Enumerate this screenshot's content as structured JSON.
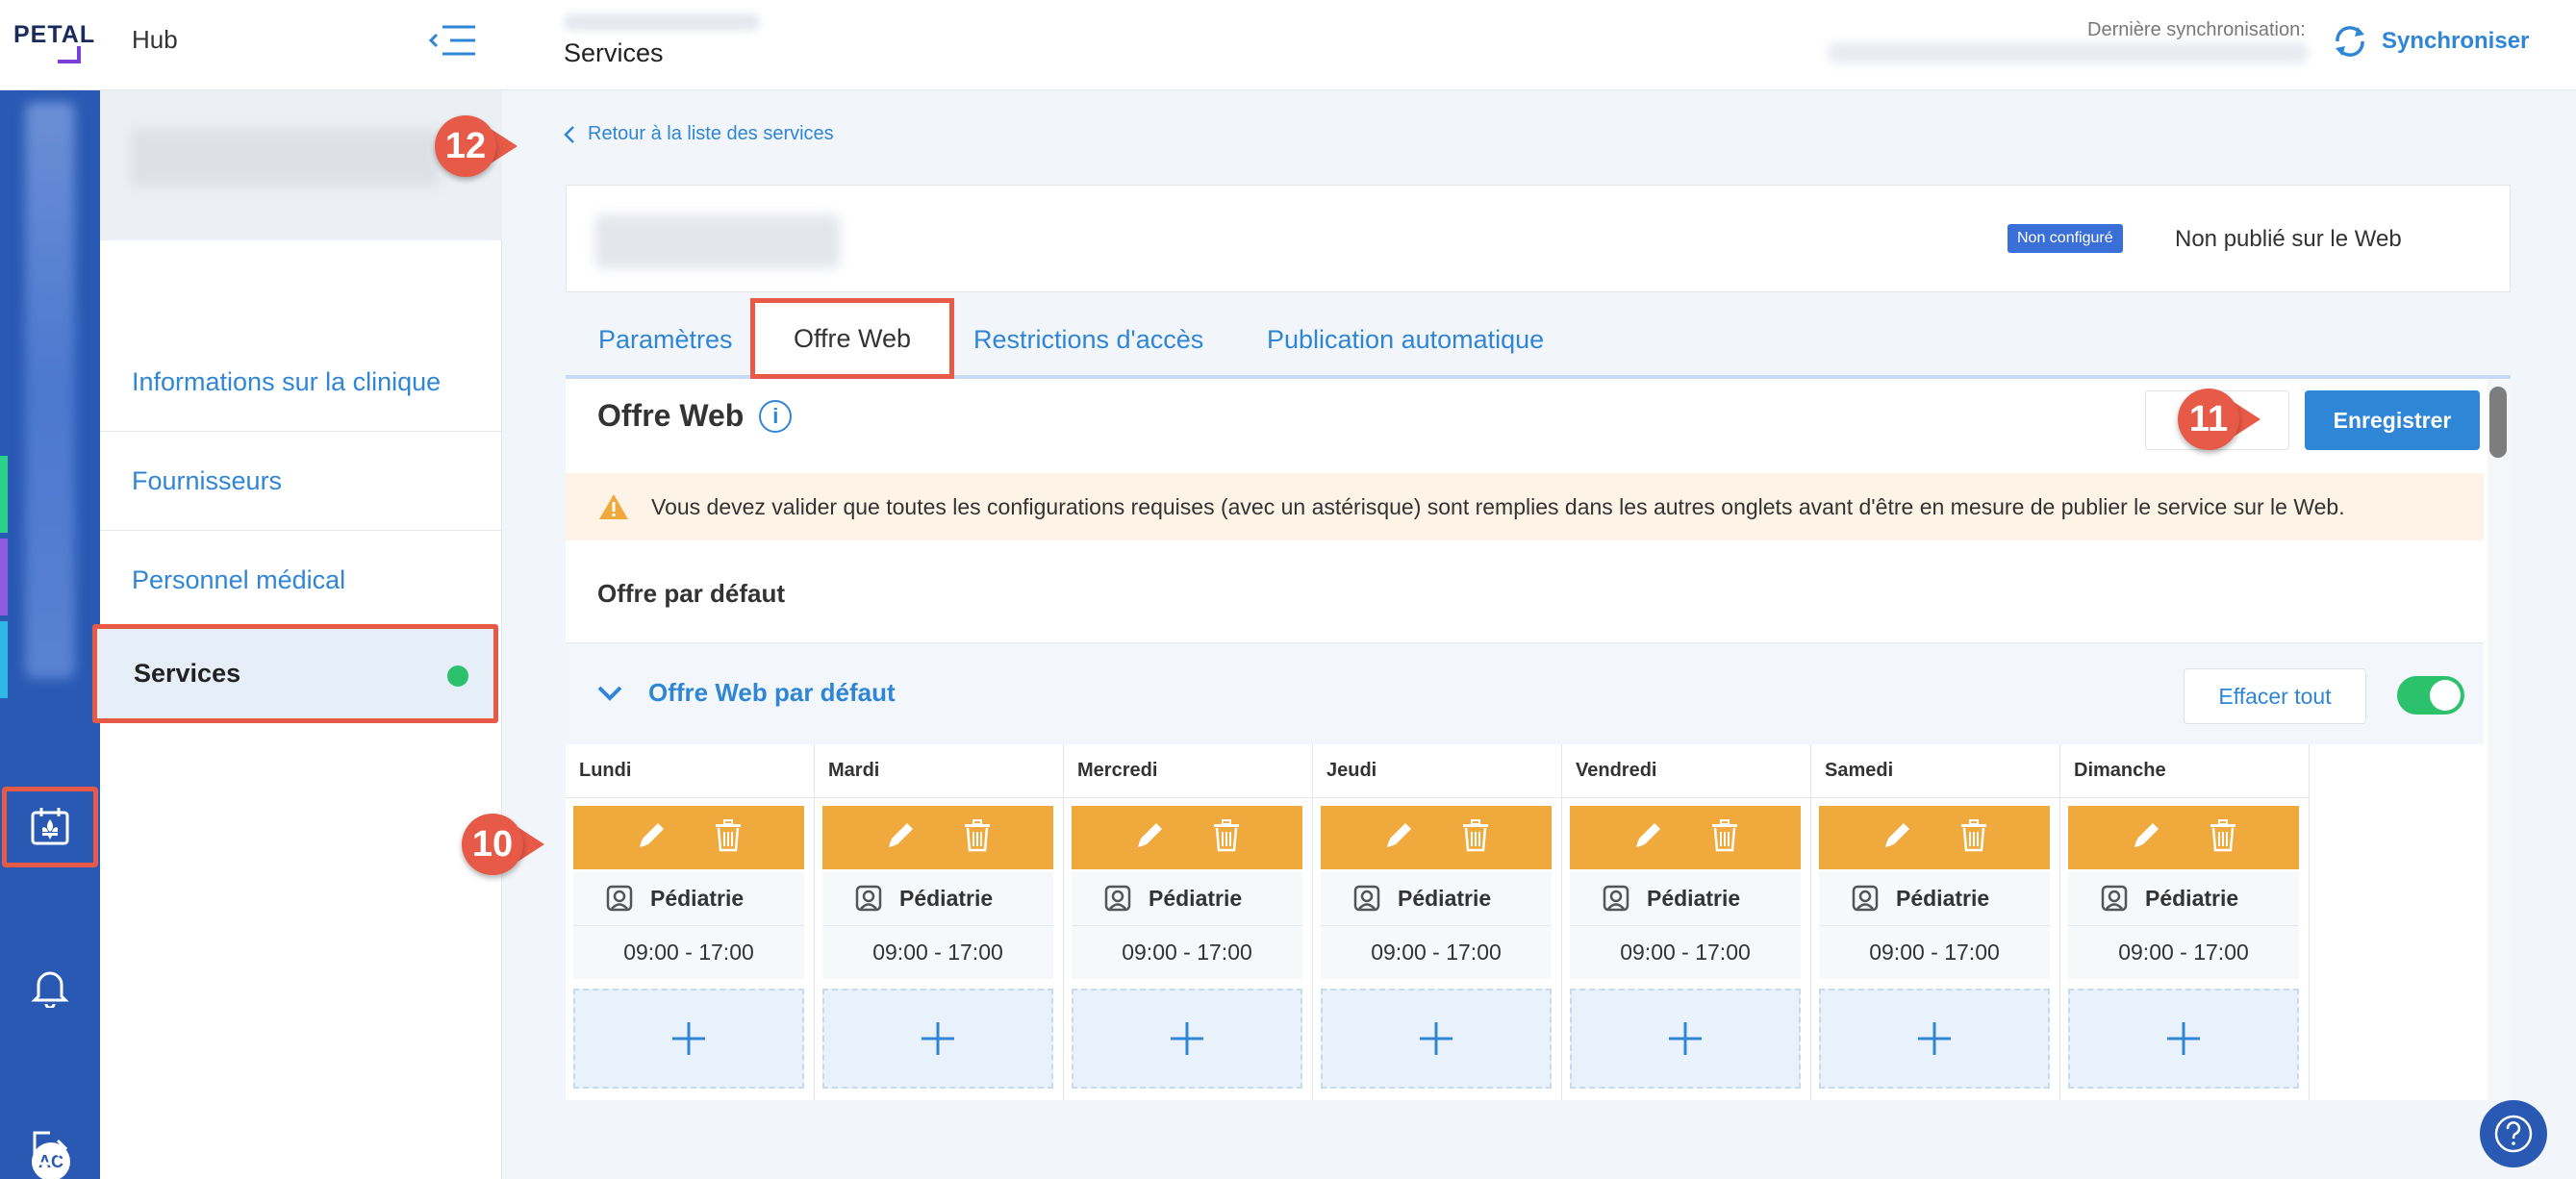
{
  "header": {
    "app_name": "Hub",
    "page_title": "Services",
    "sync_label": "Dernière synchronisation:",
    "sync_button": "Synchroniser",
    "logo_text": "PETAL"
  },
  "rail": {
    "avatar_initials": "AC"
  },
  "sidebar": {
    "items": [
      {
        "label": "Informations sur la clinique"
      },
      {
        "label": "Fournisseurs"
      },
      {
        "label": "Personnel médical"
      },
      {
        "label": "Services"
      }
    ]
  },
  "main": {
    "back_link": "Retour à la liste des services",
    "status_badge": "Non configuré",
    "publish_status": "Non publié sur le Web",
    "tabs": [
      {
        "label": "Paramètres"
      },
      {
        "label": "Offre Web"
      },
      {
        "label": "Restrictions d'accès"
      },
      {
        "label": "Publication automatique"
      }
    ],
    "panel_title": "Offre Web",
    "save_button": "Enregistrer",
    "warning": "Vous devez valider que toutes les configurations requises (avec un astérisque) sont remplies dans les autres onglets avant d'être en mesure de publier le service sur le Web.",
    "default_offer_label": "Offre par défaut",
    "offer_section_title": "Offre Web par défaut",
    "clear_button": "Effacer tout",
    "toggle_on": true,
    "days": [
      {
        "name": "Lundi",
        "service": "Pédiatrie",
        "time": "09:00 - 17:00"
      },
      {
        "name": "Mardi",
        "service": "Pédiatrie",
        "time": "09:00 - 17:00"
      },
      {
        "name": "Mercredi",
        "service": "Pédiatrie",
        "time": "09:00 - 17:00"
      },
      {
        "name": "Jeudi",
        "service": "Pédiatrie",
        "time": "09:00 - 17:00"
      },
      {
        "name": "Vendredi",
        "service": "Pédiatrie",
        "time": "09:00 - 17:00"
      },
      {
        "name": "Samedi",
        "service": "Pédiatrie",
        "time": "09:00 - 17:00"
      },
      {
        "name": "Dimanche",
        "service": "Pédiatrie",
        "time": "09:00 - 17:00"
      }
    ]
  },
  "callouts": {
    "back": "12",
    "save": "11",
    "slot": "10"
  },
  "colors": {
    "accent": "#2f86d6",
    "rail": "#2959b3",
    "slot": "#f0a93c",
    "highlight": "#e85a48",
    "toggle": "#2bc26b"
  },
  "icons": [
    "menu-collapse-icon",
    "sync-icon",
    "calendar-fleur-icon",
    "bell-icon",
    "logout-icon",
    "chevron-left-icon",
    "info-icon",
    "warning-icon",
    "chevron-down-icon",
    "pencil-icon",
    "trash-icon",
    "service-type-icon",
    "plus-icon",
    "help-icon"
  ]
}
